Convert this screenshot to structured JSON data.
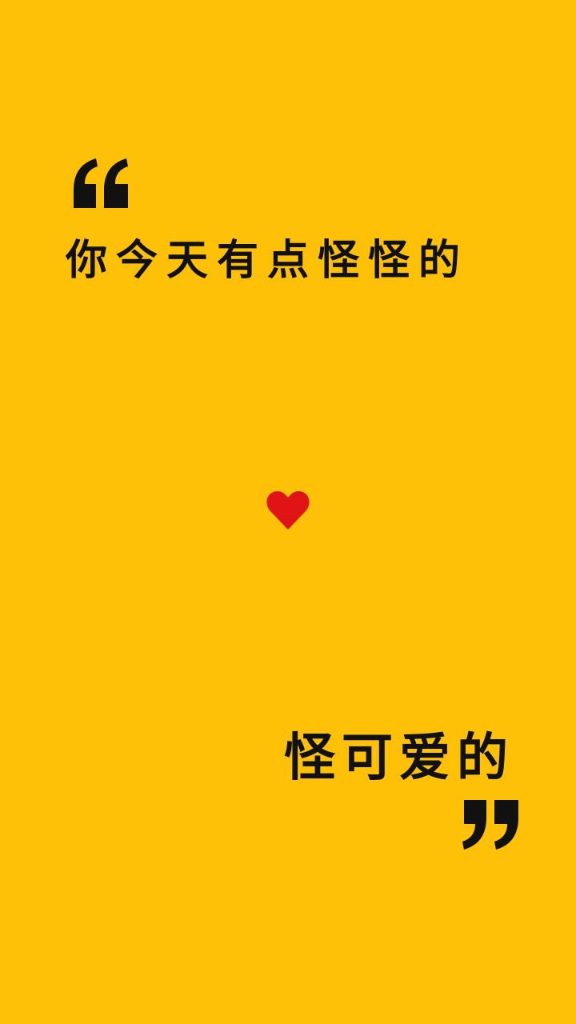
{
  "wallpaper": {
    "background_color": "#FFC107",
    "text_color": "#111111",
    "heart_color": "#E01414",
    "quote_open_icon": "open-quote-icon",
    "quote_close_icon": "close-quote-icon",
    "heart_icon": "heart-icon",
    "line_one": "你今天有点怪怪的",
    "line_two": "怪可爱的"
  }
}
